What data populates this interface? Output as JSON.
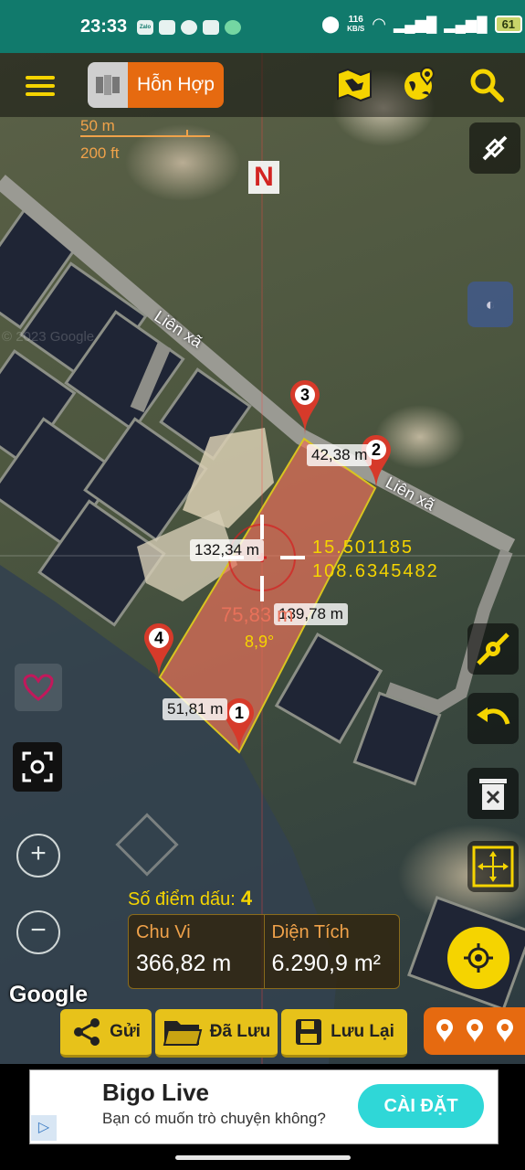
{
  "status_bar": {
    "time": "23:33",
    "apps": [
      "Zalo",
      "Photos",
      "Viber",
      "YouTube",
      "Chat"
    ],
    "network_speed_value": "116",
    "network_speed_unit": "KB/S",
    "battery": "61"
  },
  "toolbar": {
    "map_mode_label": "Hỗn Hợp",
    "icons": [
      "menu-icon",
      "map-type-icon",
      "map-folded-icon",
      "globe-pin-icon",
      "search-icon"
    ]
  },
  "scale": {
    "metric": "50 m",
    "imperial": "200 ft"
  },
  "compass": {
    "label": "N"
  },
  "map_labels": {
    "road_1": "Liên xã",
    "road_2": "Liên xã",
    "watermark": "© 2023 Google"
  },
  "markers": [
    {
      "id": "1",
      "color": "#d63a2a"
    },
    {
      "id": "2",
      "color": "#d63a2a"
    },
    {
      "id": "3",
      "color": "#d63a2a"
    },
    {
      "id": "4",
      "color": "#d63a2a"
    }
  ],
  "segment_labels": {
    "seg_2_3": "42,38 m",
    "seg_3_4": "132,34 m",
    "seg_1_2": "139,78 m",
    "seg_4_1": "51,81 m"
  },
  "crosshair": {
    "lat": "15.501185",
    "lng": "108.6345482",
    "distance": "75,83 m",
    "bearing": "8,9°"
  },
  "summary": {
    "count_label": "Số điểm dấu:",
    "count_value": "4",
    "perimeter_label": "Chu Vi",
    "perimeter_value": "366,82 m",
    "area_label": "Diện Tích",
    "area_value": "6.290,9 m²"
  },
  "attribution": "Google",
  "actions": {
    "send": "Gửi",
    "saved": "Đã Lưu",
    "save": "Lưu Lại"
  },
  "ad": {
    "title": "Bigo Live",
    "subtitle": "Bạn có muốn trò chuyện không?",
    "cta": "CÀI ĐẶT"
  },
  "colors": {
    "accent_yellow": "#f5d400",
    "accent_orange": "#e66a10",
    "status_bar": "#117a6c",
    "polygon_fill": "#e8715a",
    "coord_text": "#f5d400"
  }
}
